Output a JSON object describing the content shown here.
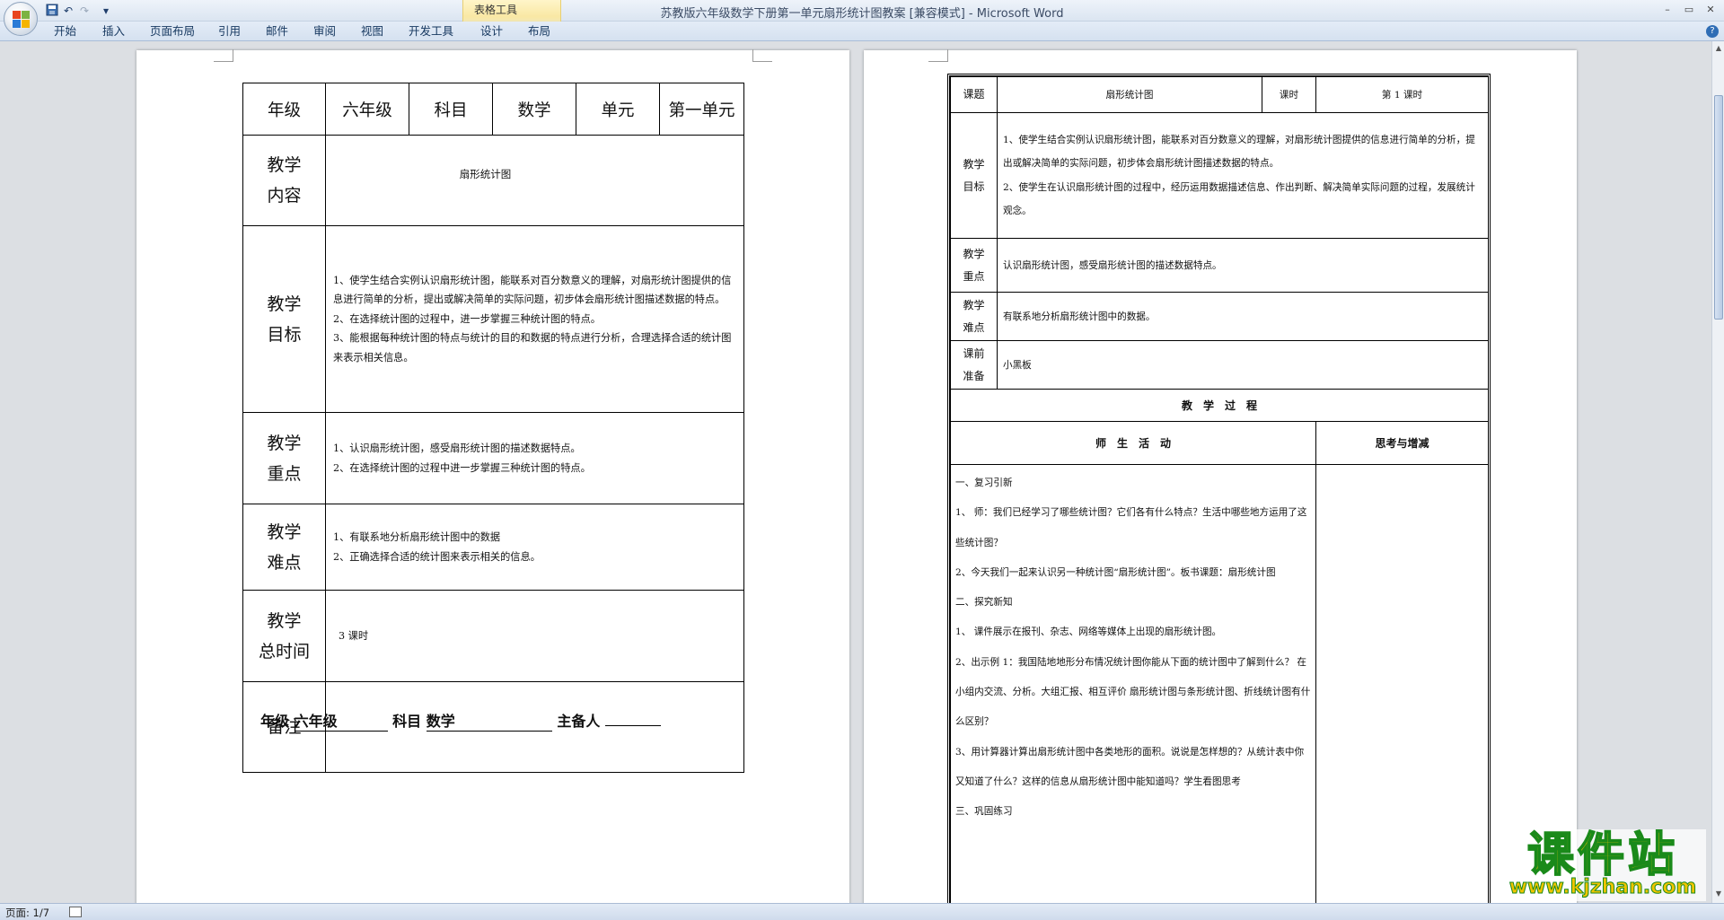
{
  "app": {
    "title": "苏教版六年级数学下册第一单元扇形统计图教案 [兼容模式] - Microsoft Word",
    "context_tab": "表格工具"
  },
  "ribbon": {
    "tabs": [
      "开始",
      "插入",
      "页面布局",
      "引用",
      "邮件",
      "审阅",
      "视图",
      "开发工具",
      "设计",
      "布局"
    ]
  },
  "qat": {
    "save": "save-icon",
    "undo": "↶",
    "redo": "↷",
    "more": "▾"
  },
  "window": {
    "minimize": "–",
    "restore": "▭",
    "close": "✕",
    "help": "?"
  },
  "page1": {
    "header": [
      "年级",
      "六年级",
      "科目",
      "数学",
      "单元",
      "第一单元"
    ],
    "content_label": [
      "教学",
      "内容"
    ],
    "content": "扇形统计图",
    "goals_label": [
      "教学",
      "目标"
    ],
    "goals": [
      "1、使学生结合实例认识扇形统计图，能联系对百分数意义的理解，对扇形统计图提供的信息进行简单的分析，提出或解决简单的实际问题，初步体会扇形统计图描述数据的特点。",
      "2、在选择统计图的过程中，进一步掌握三种统计图的特点。",
      "3、能根据每种统计图的特点与统计的目的和数据的特点进行分析，合理选择合适的统计图来表示相关信息。"
    ],
    "key_label": [
      "教学",
      "重点"
    ],
    "key": [
      "1、认识扇形统计图，感受扇形统计图的描述数据特点。",
      "2、在选择统计图的过程中进一步掌握三种统计图的特点。"
    ],
    "diff_label": [
      "教学",
      "难点"
    ],
    "diff": [
      "1、有联系地分析扇形统计图中的数据",
      "2、正确选择合适的统计图来表示相关的信息。"
    ],
    "time_label": [
      "教学",
      "总时间"
    ],
    "time": "3 课时",
    "note_label": "备注",
    "footer": {
      "grade_label": "年级",
      "grade": "六年级",
      "subject_label": "科目",
      "subject": "数学",
      "prep_label": "主备人"
    }
  },
  "page2": {
    "topic_label": "课题",
    "topic": "扇形统计图",
    "period_label": "课时",
    "period": "第 1 课时",
    "goal_label": [
      "教学",
      "目标"
    ],
    "goals": [
      "1、使学生结合实例认识扇形统计图，能联系对百分数意义的理解，对扇形统计图提供的信息进行简单的分析，提出或解决简单的实际问题，初步体会扇形统计图描述数据的特点。",
      "2、使学生在认识扇形统计图的过程中，经历运用数据描述信息、作出判断、解决简单实际问题的过程，发展统计观念。"
    ],
    "key_label": [
      "教学",
      "重点"
    ],
    "key": "认识扇形统计图，感受扇形统计图的描述数据特点。",
    "diff_label": [
      "教学",
      "难点"
    ],
    "diff": "有联系地分析扇形统计图中的数据。",
    "prep_label": [
      "课前",
      "准备"
    ],
    "prep": "小黑板",
    "process_title": "教　学　过　程",
    "col_activity": "师　生　活　动",
    "col_reflect": "思考与增减",
    "process": [
      "一、复习引新",
      "1、 师：我们已经学习了哪些统计图？它们各有什么特点？生活中哪些地方运用了这些统计图？",
      "2、今天我们一起来认识另一种统计图“扇形统计图”。板书课题：扇形统计图",
      "二、探究新知",
      "1、 课件展示在报刊、杂志、网络等媒体上出现的扇形统计图。",
      "2、出示例 1：我国陆地地形分布情况统计图你能从下面的统计图中了解到什么？ 在小组内交流、分析。大组汇报、相互评价 扇形统计图与条形统计图、折线统计图有什么区别？",
      "3、用计算器计算出扇形统计图中各类地形的面积。说说是怎样想的？从统计表中你又知道了什么？这样的信息从扇形统计图中能知道吗？学生看图思考",
      "三、巩固练习"
    ]
  },
  "status": {
    "page": "页面: 1/7"
  },
  "watermark": {
    "main": "课件站",
    "url": "www.kjzhan.com"
  },
  "colors": {
    "ribbon": "#d5e1f0",
    "workspace": "#dcdfe3",
    "context_tab": "#f9e8a4",
    "watermark_fill": "#f0c400",
    "watermark_stroke": "#1a8a1a"
  }
}
